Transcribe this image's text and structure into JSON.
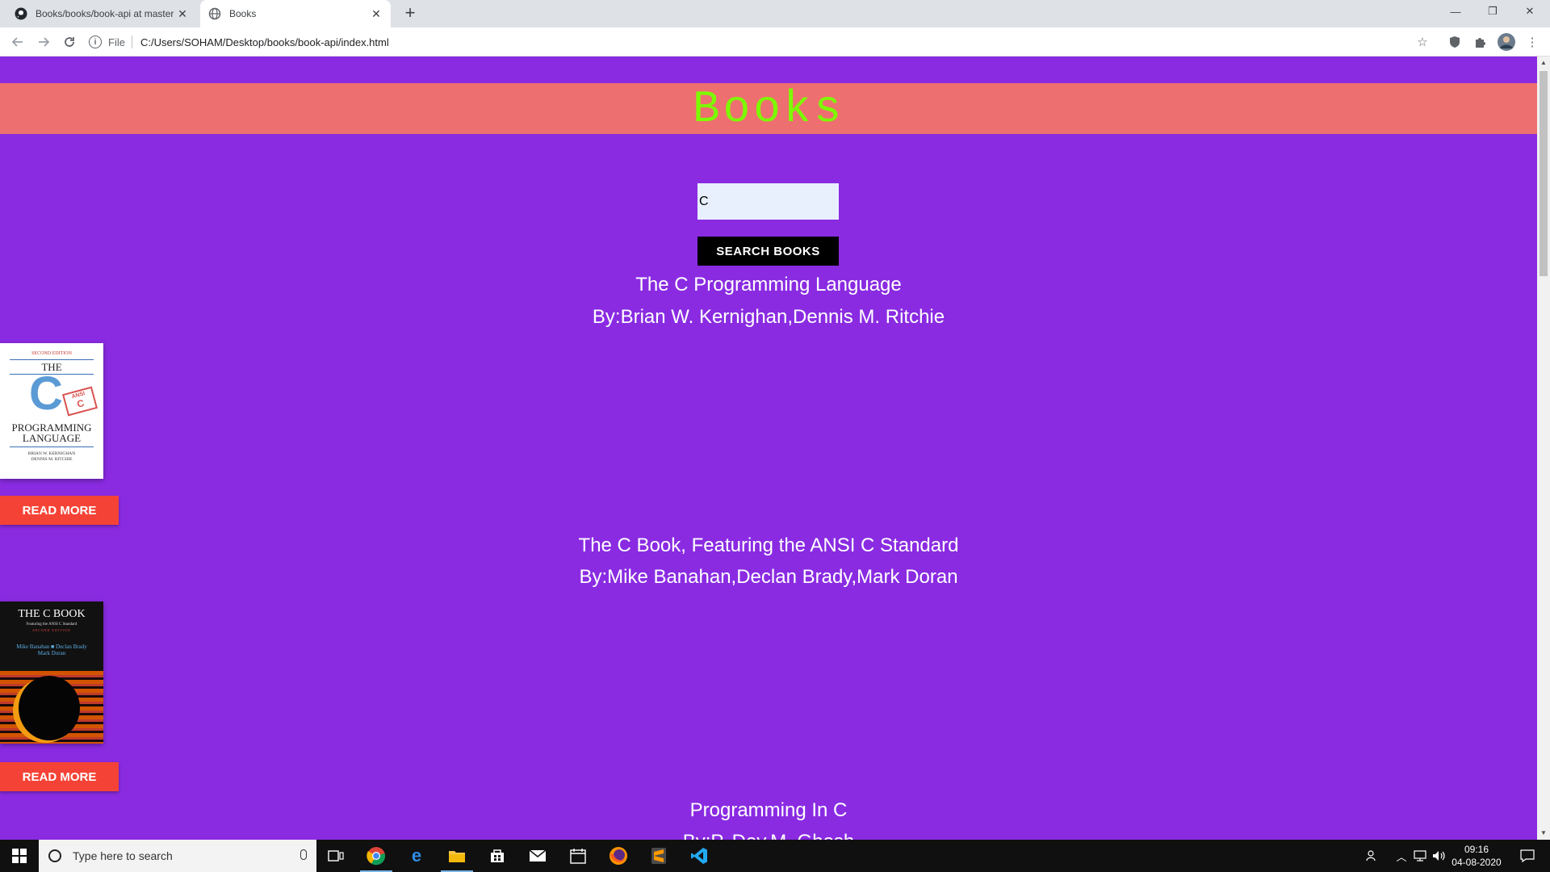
{
  "browser": {
    "tabs": [
      {
        "title": "Books/books/book-api at master · SohamChakraborty/...",
        "favicon": "github-icon",
        "active": false
      },
      {
        "title": "Books",
        "favicon": "globe-icon",
        "active": true
      }
    ],
    "address": {
      "scheme_label": "File",
      "url": "C:/Users/SOHAM/Desktop/books/book-api/index.html"
    }
  },
  "page": {
    "header_title": "Books",
    "search": {
      "value": "C",
      "button_label": "SEARCH BOOKS"
    },
    "books": [
      {
        "title": "The C Programming Language",
        "author": "By:Brian W. Kernighan,Dennis M. Ritchie",
        "read_more": "READ MORE",
        "cover": {
          "edition": "SECOND EDITION",
          "the": "THE",
          "letter": "C",
          "ansi_top": "ANSI",
          "ansi_letter": "C",
          "line1": "PROGRAMMING",
          "line2": "LANGUAGE",
          "auth1": "BRIAN W. KERNIGHAN",
          "auth2": "DENNIS M. RITCHIE"
        }
      },
      {
        "title": "The C Book, Featuring the ANSI C Standard",
        "author": "By:Mike Banahan,Declan Brady,Mark Doran",
        "read_more": "READ MORE",
        "cover": {
          "title": "THE C BOOK",
          "subtitle": "Featuring the ANSI C Standard",
          "edition": "SECOND EDITION",
          "auth1": "Mike Banahan ■ Declan Brady",
          "auth2": "Mark Doran"
        }
      },
      {
        "title": "Programming In C",
        "author": "By:P. Dey,M. Ghosh"
      }
    ]
  },
  "taskbar": {
    "search_placeholder": "Type here to search",
    "time": "09:16",
    "date": "04-08-2020"
  }
}
